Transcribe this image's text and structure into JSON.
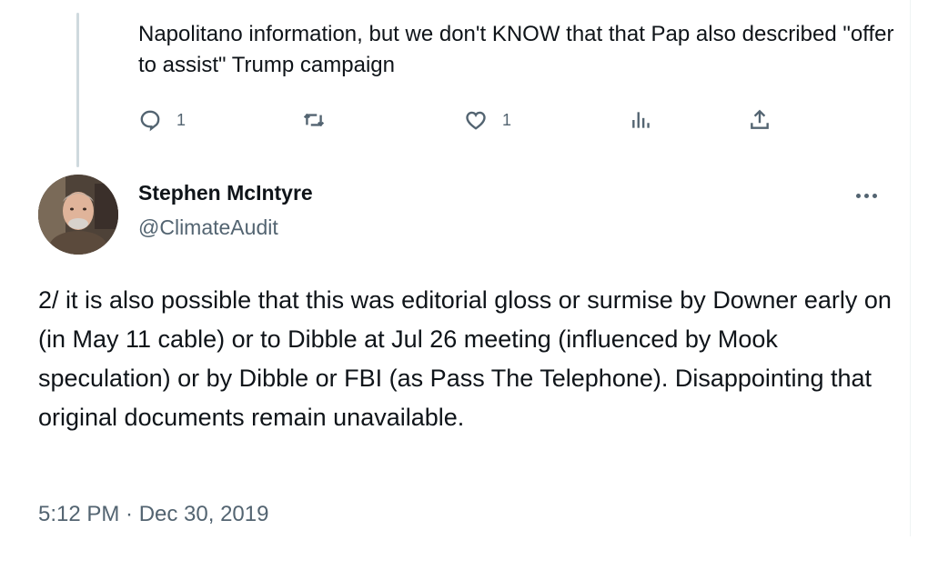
{
  "previous_tweet": {
    "text": "Napolitano information, but we don't KNOW that that Pap also described \"offer to assist\" Trump campaign",
    "actions": {
      "reply_count": "1",
      "repost_count": "",
      "like_count": "1"
    }
  },
  "tweet": {
    "author_name": "Stephen McIntyre",
    "author_handle": "@ClimateAudit",
    "text": "2/ it is also possible that this was editorial gloss or surmise by Downer early on (in May 11 cable) or to Dibble at Jul 26 meeting (influenced by Mook speculation) or by Dibble or FBI (as Pass The Telephone). Disappointing that original documents remain unavailable.",
    "timestamp": "5:12 PM · Dec 30, 2019"
  },
  "colors": {
    "text_primary": "#0f1419",
    "text_secondary": "#536471",
    "thread_line": "#cfd9de"
  },
  "icons": [
    "reply-icon",
    "repost-icon",
    "like-icon",
    "views-icon",
    "share-icon",
    "more-icon"
  ]
}
